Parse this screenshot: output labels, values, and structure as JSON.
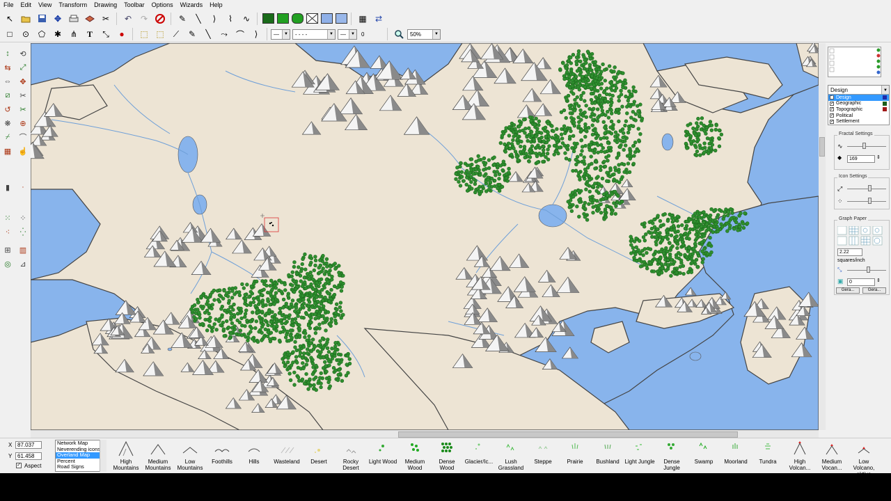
{
  "menu": [
    "File",
    "Edit",
    "View",
    "Transform",
    "Drawing",
    "Toolbar",
    "Options",
    "Wizards",
    "Help"
  ],
  "toolbar": {
    "line_style_1": "—",
    "line_style_2": "- - - -",
    "line_width": "0",
    "zoom": "50%"
  },
  "colors": {
    "land": "#ede4d4",
    "water": "#88b4ec",
    "forest": "#2f8f2f",
    "forest_dark": "#1d6a1d",
    "river": "#6e9fd8",
    "coast": "#444444"
  },
  "right_panel": {
    "layer_dropdown": "Design",
    "layers": [
      {
        "name": "Design",
        "checked": true,
        "color": "#1e2aa8",
        "selected": true
      },
      {
        "name": "Geographic",
        "checked": true,
        "color": "#1b5e1b",
        "selected": false
      },
      {
        "name": "Topographic",
        "checked": true,
        "color": "#a01818",
        "selected": false
      },
      {
        "name": "Political",
        "checked": true,
        "color": "",
        "selected": false
      },
      {
        "name": "Settlement",
        "checked": true,
        "color": "",
        "selected": false
      }
    ],
    "fractal_title": "Fractal Settings",
    "fractal_value": "169",
    "icon_title": "Icon Settings",
    "graph_title": "Graph Paper",
    "graph_value": "2.22",
    "graph_unit": "squares/inch",
    "graph_offset": "0",
    "graph_btn1": "Gera...",
    "graph_btn2": "Gera..."
  },
  "status": {
    "x_label": "X",
    "x_value": "87.037",
    "y_label": "Y",
    "y_value": "61.458",
    "aspect_label": "Aspect"
  },
  "symbol_sets": [
    {
      "label": "Network Map",
      "selected": false
    },
    {
      "label": "Neverending icons",
      "selected": false
    },
    {
      "label": "Overland Map",
      "selected": true
    },
    {
      "label": "Percent",
      "selected": false
    },
    {
      "label": "Road Signs",
      "selected": false
    }
  ],
  "terrain_symbols": [
    {
      "label": "High Mountains",
      "icon": "high-mountains"
    },
    {
      "label": "Medium Mountains",
      "icon": "medium-mountains"
    },
    {
      "label": "Low Mountains",
      "icon": "low-mountains"
    },
    {
      "label": "Foothills",
      "icon": "foothills"
    },
    {
      "label": "Hills",
      "icon": "hills"
    },
    {
      "label": "Wasteland",
      "icon": "wasteland"
    },
    {
      "label": "Desert",
      "icon": "desert"
    },
    {
      "label": "Rocky Desert",
      "icon": "rocky-desert"
    },
    {
      "label": "Light Wood",
      "icon": "light-wood"
    },
    {
      "label": "Medium Wood",
      "icon": "medium-wood"
    },
    {
      "label": "Dense Wood",
      "icon": "dense-wood"
    },
    {
      "label": "Glacier/Ic...",
      "icon": "glacier"
    },
    {
      "label": "Lush Grassland",
      "icon": "lush-grassland"
    },
    {
      "label": "Steppe",
      "icon": "steppe"
    },
    {
      "label": "Prairie",
      "icon": "prairie"
    },
    {
      "label": "Bushland",
      "icon": "bushland"
    },
    {
      "label": "Light Jungle",
      "icon": "light-jungle"
    },
    {
      "label": "Dense Jungle",
      "icon": "dense-jungle"
    },
    {
      "label": "Swamp",
      "icon": "swamp"
    },
    {
      "label": "Moorland",
      "icon": "moorland"
    },
    {
      "label": "Tundra",
      "icon": "tundra"
    },
    {
      "label": "High Volcan...",
      "icon": "high-volcano"
    },
    {
      "label": "Medium Vocan...",
      "icon": "medium-volcano"
    },
    {
      "label": "Low Volcano, aktive",
      "icon": "low-volcano"
    }
  ]
}
